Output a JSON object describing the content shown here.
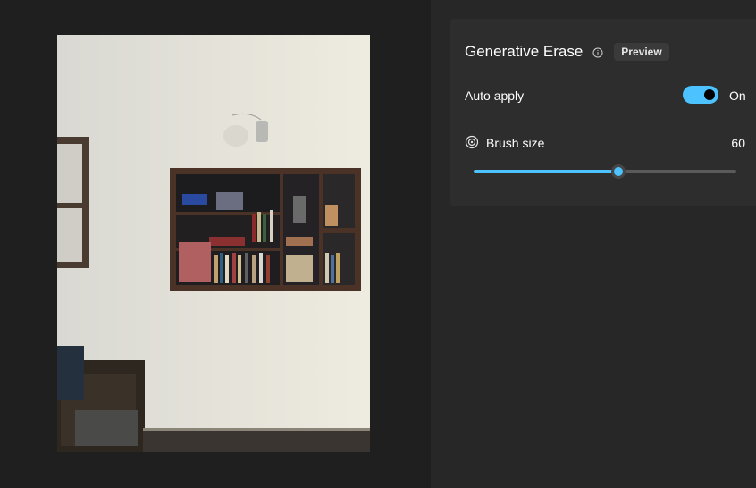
{
  "panel": {
    "title": "Generative Erase",
    "badge": "Preview",
    "auto_apply_label": "Auto apply",
    "auto_apply_state": "On",
    "auto_apply_on": true,
    "brush_label": "Brush size",
    "brush_value": "60",
    "brush_fraction": 0.55
  },
  "colors": {
    "accent": "#4cc2ff",
    "panel_bg": "#2d2d2d",
    "app_bg": "#1f1f1f"
  },
  "icons": {
    "info": "info-icon",
    "brush": "target-icon"
  }
}
